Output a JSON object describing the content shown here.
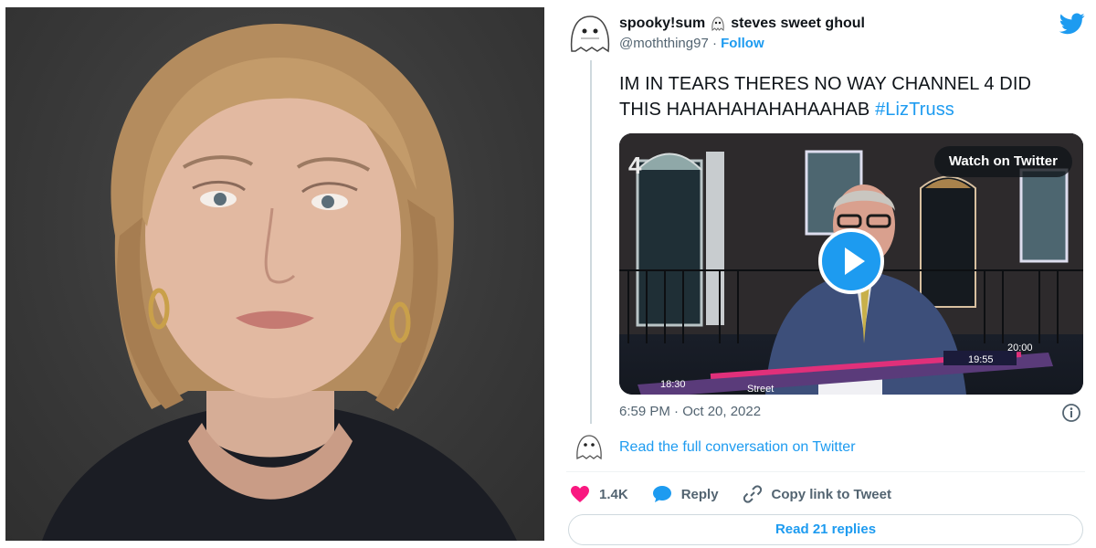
{
  "tweet": {
    "display_name": "spooky!sum",
    "display_name_suffix": "steves sweet ghoul",
    "handle": "@moththing97",
    "separator": "·",
    "follow_label": "Follow",
    "text": "IM IN TEARS THERES NO WAY CHANNEL 4 DID THIS HAHAHAHAHAHAAHAB",
    "hashtag": "#LizTruss",
    "timestamp": "6:59 PM · Oct 20, 2022",
    "read_conversation_label": "Read the full conversation on Twitter",
    "like_count": "1.4K",
    "reply_label": "Reply",
    "copy_link_label": "Copy link to Tweet",
    "read_replies_label": "Read 21 replies"
  },
  "media": {
    "watch_label": "Watch on Twitter",
    "tv_clock_1": "20:00",
    "tv_clock_2": "19:55",
    "tv_clock_3": "18:30",
    "tv_street_label": "Street",
    "channel_logo": "4"
  },
  "colors": {
    "accent": "#1d9bf0",
    "like": "#f91880",
    "text_primary": "#0f1419",
    "text_secondary": "#536471"
  },
  "icons": {
    "bird": "twitter-bird-icon",
    "play": "play-icon",
    "info": "info-icon",
    "heart": "heart-icon",
    "reply": "reply-bubble-icon",
    "link": "link-icon"
  }
}
